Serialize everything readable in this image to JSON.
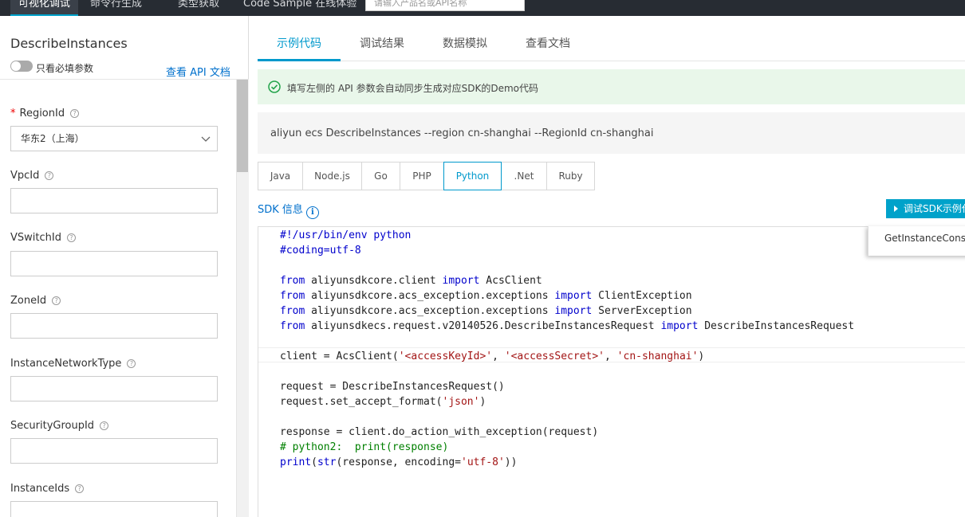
{
  "top_nav": {
    "tabs": [
      "可视化调试",
      "命令行生成",
      "类型获取",
      "Code Sample 在线体验"
    ],
    "search_placeholder": "请输入产品名或API名称"
  },
  "left_panel": {
    "api_name": "DescribeInstances",
    "required_only_label": "只看必填参数",
    "api_doc_link": "查看 API 文档",
    "fields": [
      {
        "label": "RegionId",
        "required": true,
        "value": "华东2（上海）",
        "type": "select"
      },
      {
        "label": "VpcId",
        "required": false,
        "value": ""
      },
      {
        "label": "VSwitchId",
        "required": false,
        "value": ""
      },
      {
        "label": "ZoneId",
        "required": false,
        "value": ""
      },
      {
        "label": "InstanceNetworkType",
        "required": false,
        "value": ""
      },
      {
        "label": "SecurityGroupId",
        "required": false,
        "value": ""
      },
      {
        "label": "InstanceIds",
        "required": false,
        "value": ""
      }
    ]
  },
  "right_panel": {
    "tabs": [
      "示例代码",
      "调试结果",
      "数据模拟",
      "查看文档"
    ],
    "active_tab": "示例代码",
    "notice": "填写左侧的 API 参数会自动同步生成对应SDK的Demo代码",
    "cli_command": "aliyun ecs DescribeInstances --region cn-shanghai --RegionId cn-shanghai",
    "languages": [
      "Java",
      "Node.js",
      "Go",
      "PHP",
      "Python",
      ".Net",
      "Ruby"
    ],
    "active_language": "Python",
    "sdk_info_label": "SDK 信息",
    "debug_button": "调试SDK示例代码",
    "popup_item": "GetInstanceConsoleOutput",
    "code_lines": [
      "#!/usr/bin/env python",
      "#coding=utf-8",
      "",
      "from aliyunsdkcore.client import AcsClient",
      "from aliyunsdkcore.acs_exception.exceptions import ClientException",
      "from aliyunsdkcore.acs_exception.exceptions import ServerException",
      "from aliyunsdkecs.request.v20140526.DescribeInstancesRequest import DescribeInstancesRequest",
      "",
      "client = AcsClient('<accessKeyId>', '<accessSecret>', 'cn-shanghai')",
      "",
      "request = DescribeInstancesRequest()",
      "request.set_accept_format('json')",
      "",
      "response = client.do_action_with_exception(request)",
      "# python2:  print(response)",
      "print(str(response, encoding='utf-8'))"
    ]
  },
  "colors": {
    "accent": "#0099cc",
    "topbar_bg": "#272c33",
    "notice_bg": "#e9f7ea",
    "success_icon": "#22a34a"
  }
}
